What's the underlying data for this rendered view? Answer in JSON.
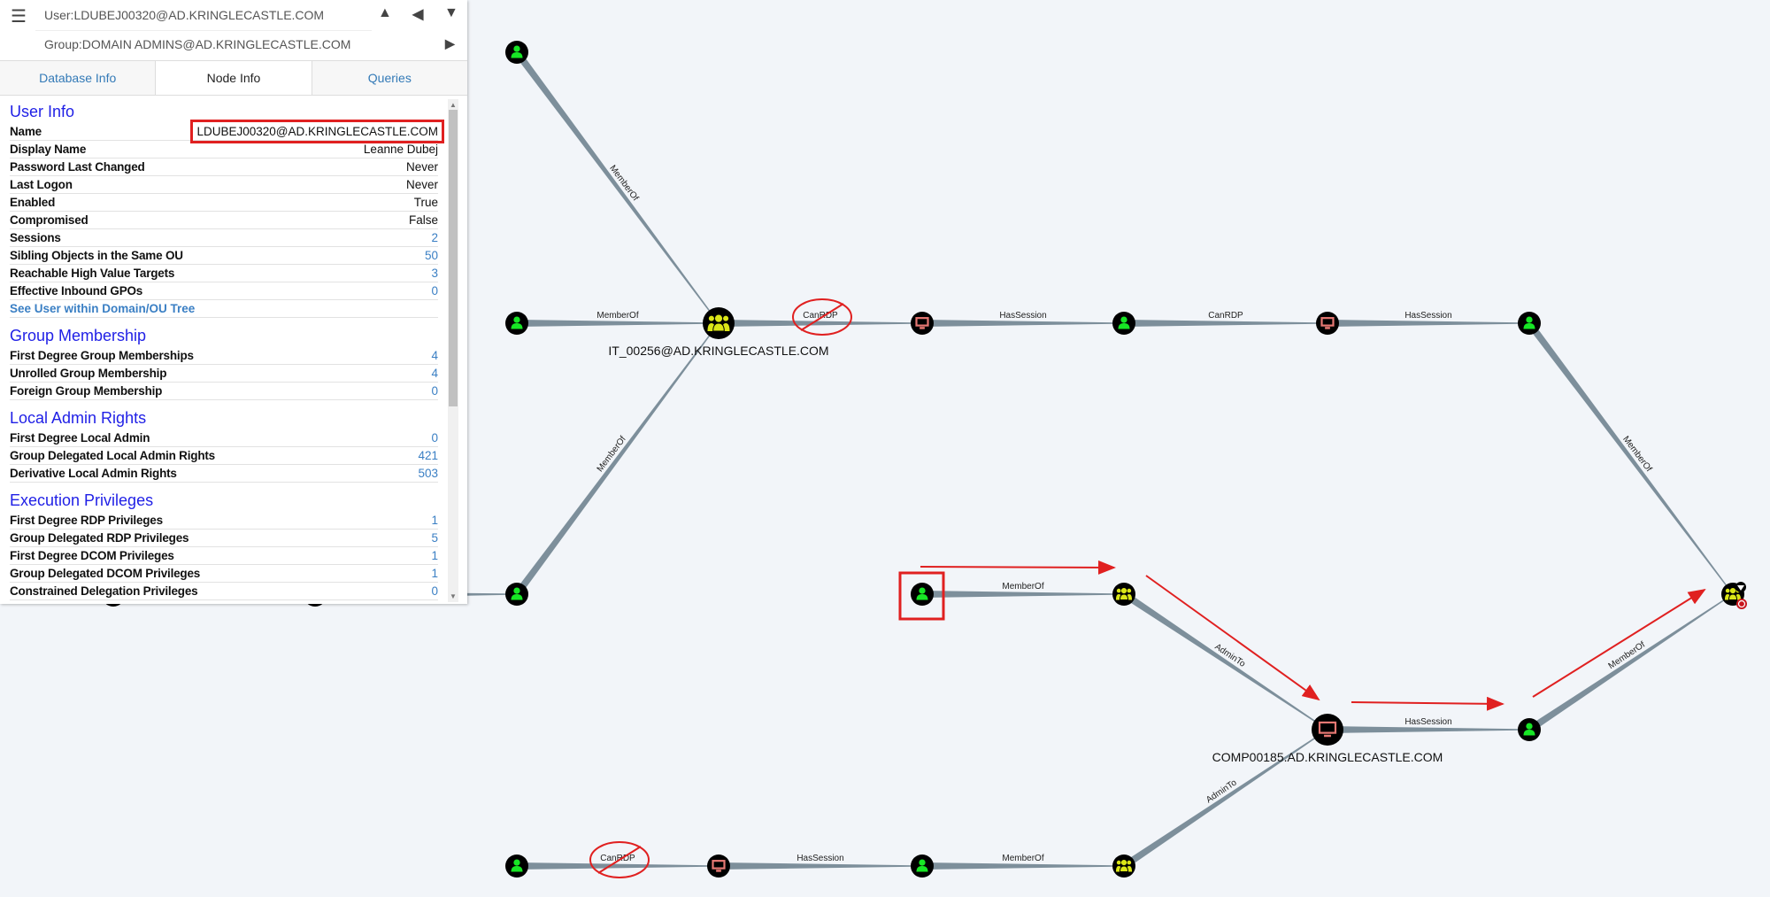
{
  "search": {
    "start_node": "User:LDUBEJ00320@AD.KRINGLECASTLE.COM",
    "target_node": "Group:DOMAIN ADMINS@AD.KRINGLECASTLE.COM",
    "icons": {
      "menu": "hamburger-icon",
      "pathfind": "road-icon",
      "back": "skip-back-icon",
      "filter": "filter-icon",
      "play": "play-icon"
    }
  },
  "tabs": [
    {
      "label": "Database Info",
      "active": false
    },
    {
      "label": "Node Info",
      "active": true
    },
    {
      "label": "Queries",
      "active": false
    }
  ],
  "node_info": {
    "user_info": {
      "heading": "User Info",
      "rows": [
        {
          "k": "Name",
          "v": "LDUBEJ00320@AD.KRINGLECASTLE.COM"
        },
        {
          "k": "Display Name",
          "v": "Leanne Dubej"
        },
        {
          "k": "Password Last Changed",
          "v": "Never"
        },
        {
          "k": "Last Logon",
          "v": "Never"
        },
        {
          "k": "Enabled",
          "v": "True"
        },
        {
          "k": "Compromised",
          "v": "False"
        },
        {
          "k": "Sessions",
          "v": "2"
        },
        {
          "k": "Sibling Objects in the Same OU",
          "v": "50"
        },
        {
          "k": "Reachable High Value Targets",
          "v": "3"
        },
        {
          "k": "Effective Inbound GPOs",
          "v": "0"
        }
      ],
      "link": "See User within Domain/OU Tree"
    },
    "group_membership": {
      "heading": "Group Membership",
      "rows": [
        {
          "k": "First Degree Group Memberships",
          "v": "4"
        },
        {
          "k": "Unrolled Group Membership",
          "v": "4"
        },
        {
          "k": "Foreign Group Membership",
          "v": "0"
        }
      ]
    },
    "local_admin": {
      "heading": "Local Admin Rights",
      "rows": [
        {
          "k": "First Degree Local Admin",
          "v": "0"
        },
        {
          "k": "Group Delegated Local Admin Rights",
          "v": "421"
        },
        {
          "k": "Derivative Local Admin Rights",
          "v": "503"
        }
      ]
    },
    "execution": {
      "heading": "Execution Privileges",
      "rows": [
        {
          "k": "First Degree RDP Privileges",
          "v": "1"
        },
        {
          "k": "Group Delegated RDP Privileges",
          "v": "5"
        },
        {
          "k": "First Degree DCOM Privileges",
          "v": "1"
        },
        {
          "k": "Group Delegated DCOM Privileges",
          "v": "1"
        },
        {
          "k": "Constrained Delegation Privileges",
          "v": "0"
        }
      ]
    }
  },
  "graph": {
    "colors": {
      "user": "#17e625",
      "group": "#dbe617",
      "computer": "#e67873",
      "edge": "#7d8f9b",
      "annotation": "#e02020",
      "background": "#f2f5f9"
    },
    "nodes": [
      {
        "id": "A",
        "type": "user"
      },
      {
        "id": "B",
        "type": "user"
      },
      {
        "id": "C",
        "type": "group",
        "label": "IT_00256@AD.KRINGLECASTLE.COM"
      },
      {
        "id": "D",
        "type": "computer"
      },
      {
        "id": "E",
        "type": "user"
      },
      {
        "id": "F",
        "type": "computer"
      },
      {
        "id": "G",
        "type": "user"
      },
      {
        "id": "H",
        "type": "user"
      },
      {
        "id": "I",
        "type": "user"
      },
      {
        "id": "J",
        "type": "group"
      },
      {
        "id": "K",
        "type": "computer",
        "label": "COMP00185.AD.KRINGLECASTLE.COM"
      },
      {
        "id": "L",
        "type": "user"
      },
      {
        "id": "M",
        "type": "group",
        "badges": [
          "high-value-gem-icon",
          "target-icon"
        ]
      },
      {
        "id": "N",
        "type": "user"
      },
      {
        "id": "O",
        "type": "computer"
      },
      {
        "id": "P",
        "type": "user"
      },
      {
        "id": "Q",
        "type": "group"
      },
      {
        "id": "X1",
        "type": "user"
      },
      {
        "id": "X2",
        "type": "user"
      }
    ],
    "edges": [
      {
        "s": "A",
        "t": "C",
        "label": "MemberOf"
      },
      {
        "s": "B",
        "t": "C",
        "label": "MemberOf"
      },
      {
        "s": "H",
        "t": "C",
        "label": "MemberOf"
      },
      {
        "s": "C",
        "t": "D",
        "label": "CanRDP",
        "crossed": true
      },
      {
        "s": "D",
        "t": "E",
        "label": "HasSession"
      },
      {
        "s": "E",
        "t": "F",
        "label": "CanRDP"
      },
      {
        "s": "F",
        "t": "G",
        "label": "HasSession"
      },
      {
        "s": "G",
        "t": "M",
        "label": "MemberOf"
      },
      {
        "s": "I",
        "t": "J",
        "label": "MemberOf"
      },
      {
        "s": "J",
        "t": "K",
        "label": "AdminTo"
      },
      {
        "s": "K",
        "t": "L",
        "label": "HasSession"
      },
      {
        "s": "L",
        "t": "M",
        "label": "MemberOf"
      },
      {
        "s": "N",
        "t": "O",
        "label": "CanRDP",
        "crossed": true
      },
      {
        "s": "O",
        "t": "P",
        "label": "HasSession"
      },
      {
        "s": "P",
        "t": "Q",
        "label": "MemberOf"
      },
      {
        "s": "Q",
        "t": "K",
        "label": "AdminTo"
      },
      {
        "s": "X2",
        "t": "H",
        "label": ""
      }
    ],
    "highlighted_node": "I"
  }
}
